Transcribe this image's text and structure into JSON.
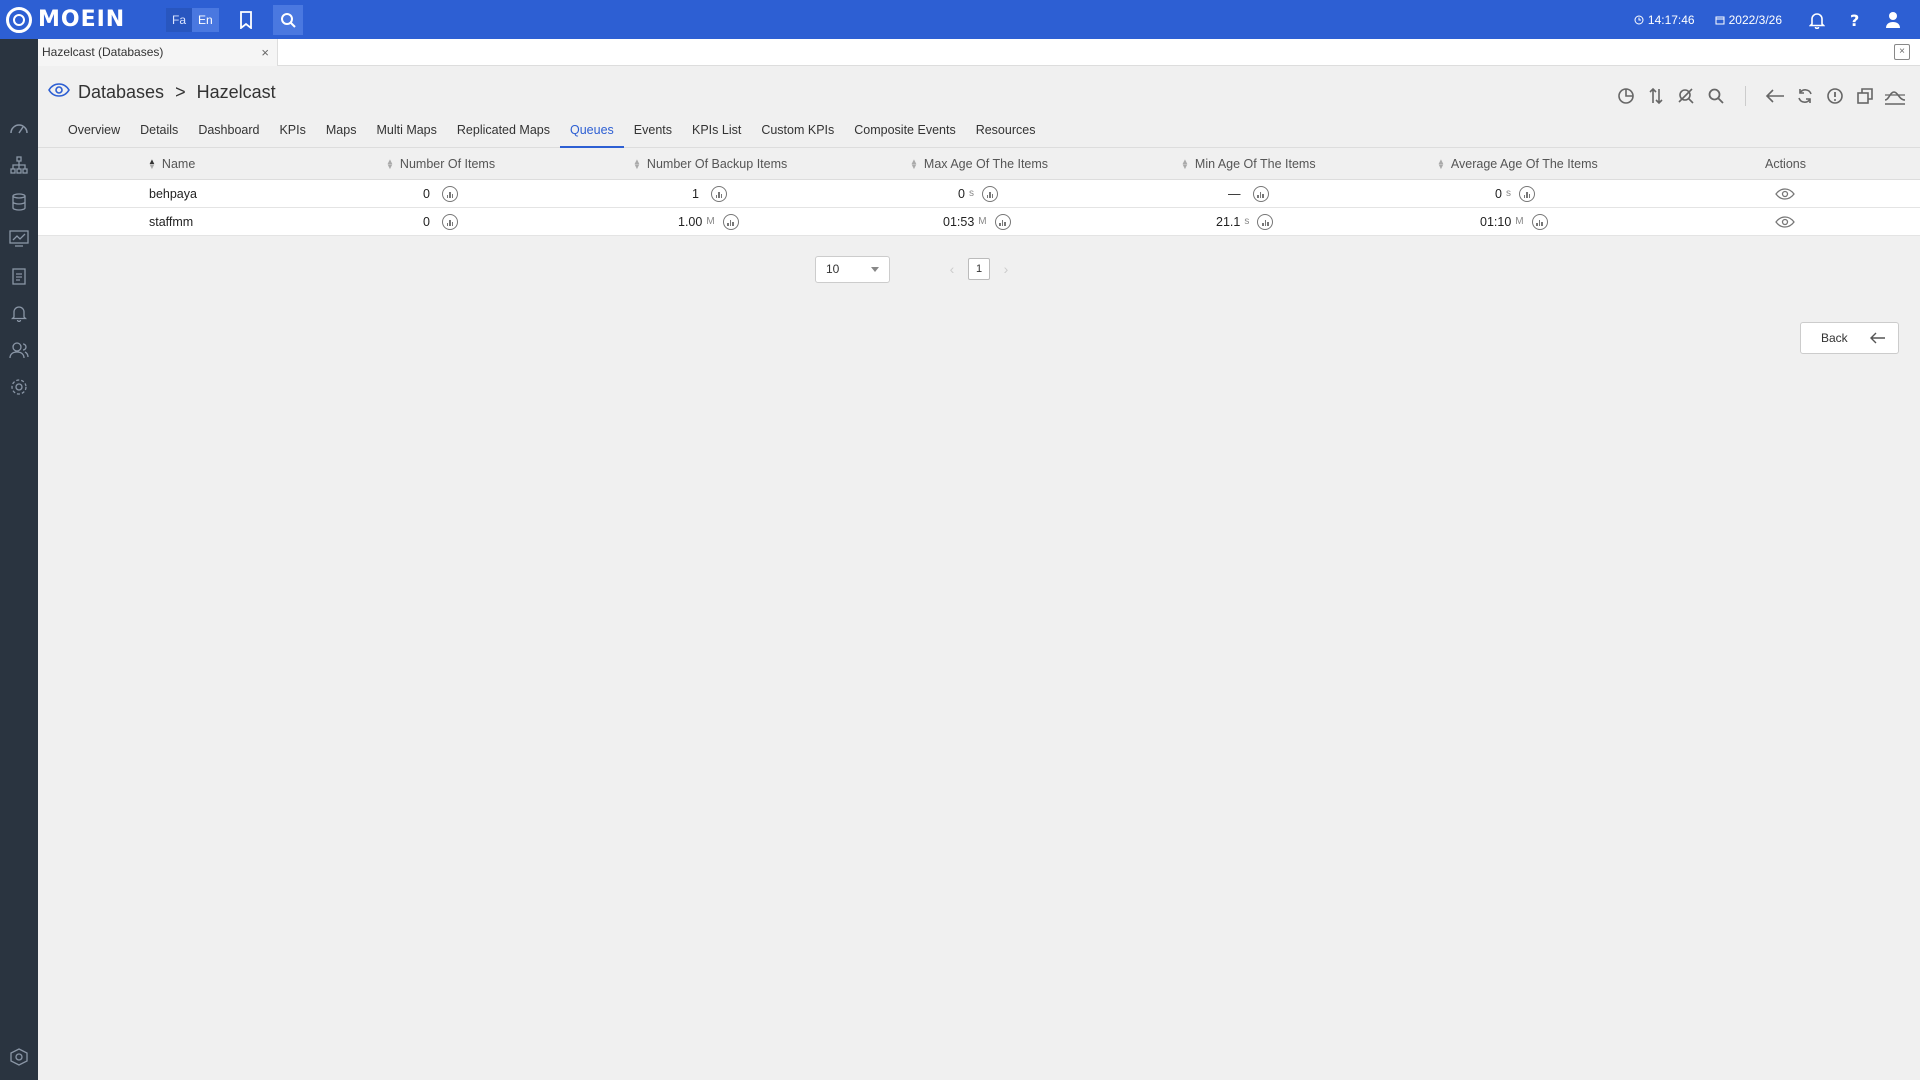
{
  "app": {
    "logo_text": "MOEIN",
    "lang_fa": "Fa",
    "lang_en": "En",
    "time": "14:17:46",
    "date": "2022/3/26"
  },
  "doc_tab": {
    "label": "Hazelcast (Databases)",
    "close": "×"
  },
  "breadcrumb": {
    "parent": "Databases",
    "sep": ">",
    "current": "Hazelcast"
  },
  "tabs": [
    {
      "label": "Overview"
    },
    {
      "label": "Details"
    },
    {
      "label": "Dashboard"
    },
    {
      "label": "KPIs"
    },
    {
      "label": "Maps"
    },
    {
      "label": "Multi Maps"
    },
    {
      "label": "Replicated Maps"
    },
    {
      "label": "Queues",
      "active": true
    },
    {
      "label": "Events"
    },
    {
      "label": "KPIs List"
    },
    {
      "label": "Custom KPIs"
    },
    {
      "label": "Composite Events"
    },
    {
      "label": "Resources"
    }
  ],
  "table": {
    "columns": [
      "Name",
      "Number Of Items",
      "Number Of Backup Items",
      "Max Age Of The Items",
      "Min Age Of The Items",
      "Average Age Of The Items",
      "Actions"
    ],
    "rows": [
      {
        "name": "behpaya",
        "items": "0",
        "items_unit": "",
        "backup": "1",
        "backup_unit": "",
        "max_age": "0",
        "max_age_unit": "s",
        "min_age": "—",
        "min_age_unit": "",
        "avg_age": "0",
        "avg_age_unit": "s"
      },
      {
        "name": "staffmm",
        "items": "0",
        "items_unit": "",
        "backup": "1.00",
        "backup_unit": "M",
        "max_age": "01:53",
        "max_age_unit": "M",
        "min_age": "21.1",
        "min_age_unit": "s",
        "avg_age": "01:10",
        "avg_age_unit": "M"
      }
    ]
  },
  "pagination": {
    "page_size": "10",
    "prev": "‹",
    "current_page": "1",
    "next": "›"
  },
  "back_button": {
    "label": "Back"
  },
  "colors": {
    "topbar": "#2d5fd3",
    "sidebar": "#2a3440",
    "accent": "#2d5fd3"
  }
}
